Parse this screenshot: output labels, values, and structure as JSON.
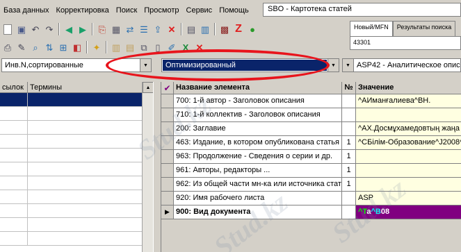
{
  "menubar": {
    "items": [
      "База данных",
      "Корректировка",
      "Поиск",
      "Просмотр",
      "Сервис",
      "Помощь"
    ]
  },
  "window": {
    "title": "SBO - Картотека статей"
  },
  "right_panel": {
    "tabs": [
      "Новый/MFN",
      "Результаты поиска"
    ],
    "mfn_value": "43301"
  },
  "combos": {
    "sort_mode": "Инв.N,сортированные",
    "view_mode": "Оптимизированный",
    "worksheet": "ASP42 - Аналитическое описание"
  },
  "left_table": {
    "headers": [
      "сылок",
      "Термины"
    ]
  },
  "record_grid": {
    "headers": {
      "name": "Название элемента",
      "num": "№",
      "value": "Значение"
    },
    "rows": [
      {
        "name": "700: 1-й  автор - Заголовок описания",
        "num": "",
        "value": "^AИманғалиева^BН."
      },
      {
        "name": "710: 1-й коллектив - Заголовок описания",
        "num": "",
        "value": ""
      },
      {
        "name": "200: Заглавие",
        "num": "",
        "value": "^AХ.Досмұхамедовтың жаңа"
      },
      {
        "name": "463: Издание, в котором опубликована статья",
        "num": "1",
        "value": "^CБілім-Образование^J2008^"
      },
      {
        "name": "963: Продолжение - Сведения о серии и др.",
        "num": "1",
        "value": ""
      },
      {
        "name": "961: Авторы, редакторы ...",
        "num": "1",
        "value": ""
      },
      {
        "name": "962: Из общей части мн-ка или источника статьи",
        "num": "1",
        "value": ""
      },
      {
        "name": "920: Имя рабочего листа",
        "num": "",
        "value": "ASP"
      },
      {
        "name": "900: Вид документа",
        "num": "",
        "value_parts": [
          "^T",
          "a",
          "^B",
          "08"
        ]
      }
    ]
  },
  "watermark": {
    "text": "Stud.kz"
  },
  "icons": [
    "new-icon",
    "save-icon",
    "undo-icon",
    "redo-icon",
    "back-icon",
    "forward-icon",
    "delete-icon",
    "print-icon",
    "z-icon",
    "globe-icon"
  ],
  "colors": {
    "selection": "#0a246a",
    "highlight_ellipse": "#e8141c",
    "value_bg": "#ffffe1",
    "doc_type_bg": "#800080"
  }
}
